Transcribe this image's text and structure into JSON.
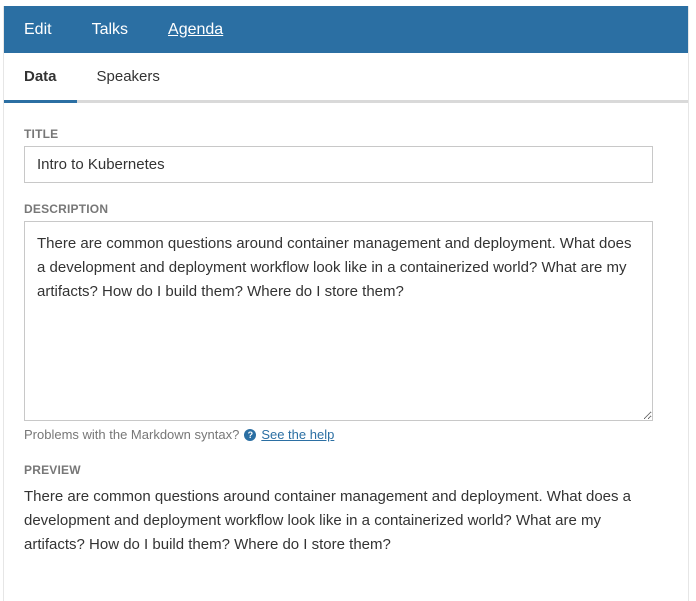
{
  "nav": {
    "items": [
      {
        "label": "Edit"
      },
      {
        "label": "Talks"
      },
      {
        "label": "Agenda"
      }
    ]
  },
  "tabs": [
    {
      "label": "Data"
    },
    {
      "label": "Speakers"
    }
  ],
  "form": {
    "title_label": "TITLE",
    "title_value": "Intro to Kubernetes",
    "description_label": "DESCRIPTION",
    "description_value": "There are common questions around container management and deployment. What does a development and deployment workflow look like in a containerized world? What are my artifacts? How do I build them? Where do I store them?",
    "help_text": "Problems with the Markdown syntax?",
    "help_icon": "question-circle-icon",
    "help_link": "See the help",
    "preview_label": "PREVIEW",
    "preview_text": "There are common questions around container management and deployment. What does a development and deployment workflow look like in a containerized world? What are my artifacts? How do I build them? Where do I store them?"
  },
  "colors": {
    "accent": "#2b6fa3",
    "label": "#777777"
  }
}
